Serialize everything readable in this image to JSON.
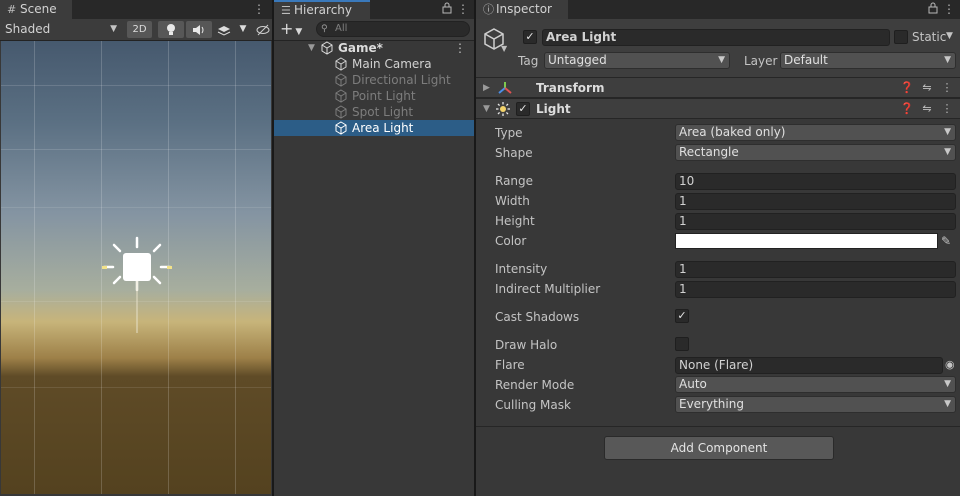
{
  "scene": {
    "tab_label": "Scene",
    "shading_mode": "Shaded",
    "btn_2d": "2D"
  },
  "hierarchy": {
    "tab_label": "Hierarchy",
    "search_placeholder": "All",
    "scene_name": "Game*",
    "items": [
      {
        "label": "Main Camera",
        "enabled": true
      },
      {
        "label": "Directional Light",
        "enabled": false
      },
      {
        "label": "Point Light",
        "enabled": false
      },
      {
        "label": "Spot Light",
        "enabled": false
      },
      {
        "label": "Area Light",
        "enabled": true,
        "selected": true
      }
    ]
  },
  "inspector": {
    "tab_label": "Inspector",
    "object_name": "Area Light",
    "static_label": "Static",
    "tag_label": "Tag",
    "tag_value": "Untagged",
    "layer_label": "Layer",
    "layer_value": "Default",
    "transform_title": "Transform",
    "light_title": "Light",
    "props": {
      "type_label": "Type",
      "type_value": "Area (baked only)",
      "shape_label": "Shape",
      "shape_value": "Rectangle",
      "range_label": "Range",
      "range_value": "10",
      "width_label": "Width",
      "width_value": "1",
      "height_label": "Height",
      "height_value": "1",
      "color_label": "Color",
      "color_value": "#ffffff",
      "intensity_label": "Intensity",
      "intensity_value": "1",
      "indirect_label": "Indirect Multiplier",
      "indirect_value": "1",
      "cast_shadows_label": "Cast Shadows",
      "cast_shadows": true,
      "draw_halo_label": "Draw Halo",
      "draw_halo": false,
      "flare_label": "Flare",
      "flare_value": "None (Flare)",
      "render_mode_label": "Render Mode",
      "render_mode_value": "Auto",
      "culling_label": "Culling Mask",
      "culling_value": "Everything"
    },
    "add_component": "Add Component"
  },
  "colors": {
    "selection": "#2c5d87",
    "tab_accent": "#3a79bb",
    "panel_bg": "#383838"
  }
}
